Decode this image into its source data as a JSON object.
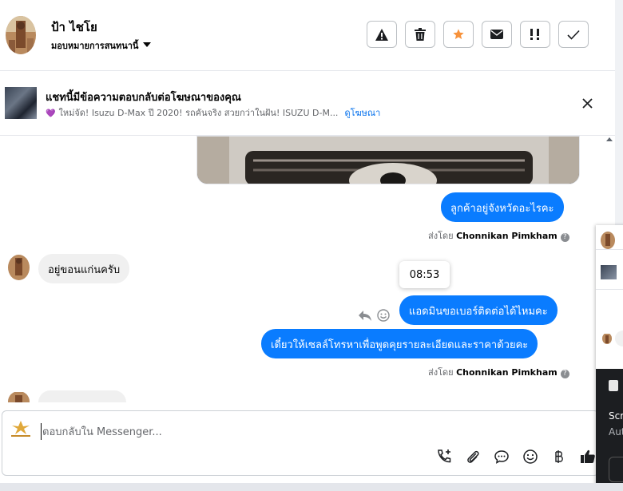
{
  "header": {
    "contact_name": "ป้า ไชโย",
    "assign_label": "มอบหมายการสนทนานี้",
    "toolbar_icons": [
      "warning-icon",
      "trash-icon",
      "star-icon",
      "envelope-icon",
      "priority-icon",
      "check-icon"
    ]
  },
  "ad_banner": {
    "title": "แชทนี้มีข้อความตอบกลับต่อโฆษณาของคุณ",
    "subtitle": "ใหม่จัด! Isuzu D-Max ปี 2020! รถคันจริง สวยกว่าในฝัน! ISUZU D-M...",
    "link": "ดูโฆษณา",
    "heart": "💜"
  },
  "messages": [
    {
      "type": "image",
      "direction": "out"
    },
    {
      "type": "text",
      "direction": "out",
      "text": "ลูกค้าอยู่จังหวัดอะไรคะ"
    },
    {
      "type": "sentby",
      "prefix": "ส่งโดย",
      "name": "Chonnikan Pimkham"
    },
    {
      "type": "text",
      "direction": "in",
      "text": "อยู่ขอนแก่นครับ"
    },
    {
      "type": "text",
      "direction": "out",
      "text": "แอดมินขอเบอร์ติดต่อได้ไหมคะ"
    },
    {
      "type": "text",
      "direction": "out",
      "text": "เดี๋ยวให้เซลล์โทรหาเพื่อพูดคุยรายละเอียดและราคาด้วยคะ"
    },
    {
      "type": "sentby",
      "prefix": "ส่งโดย",
      "name": "Chonnikan Pimkham"
    }
  ],
  "tooltip_time": "08:53",
  "composer": {
    "placeholder": "ตอบกลับใน Messenger...",
    "icons": [
      "call-add-icon",
      "attachment-icon",
      "saved-reply-icon",
      "emoji-icon",
      "baht-icon",
      "thumbs-up-icon"
    ]
  },
  "side_window": {
    "text1": "Scr",
    "text2": "Aut"
  },
  "colors": {
    "accent": "#0a7cff",
    "link": "#0571ed",
    "star": "#f7923b"
  }
}
